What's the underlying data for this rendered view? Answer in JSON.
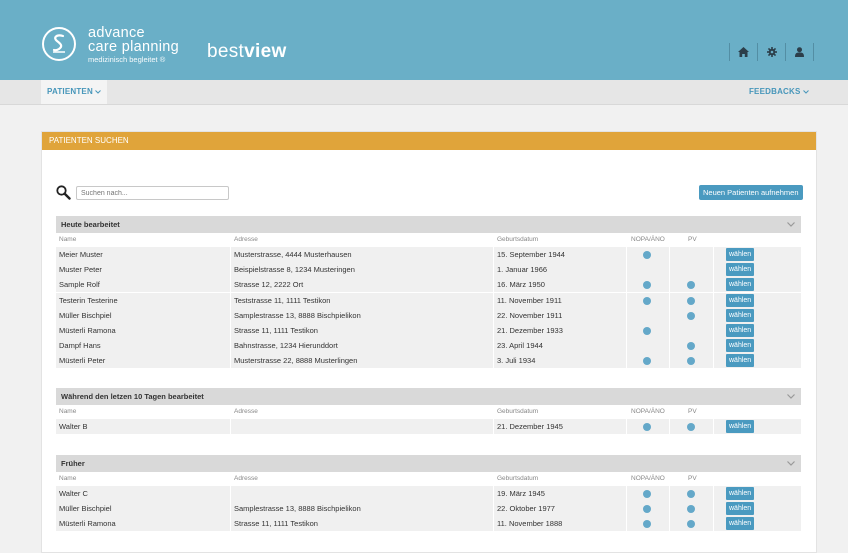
{
  "header": {
    "logo_line1": "advance",
    "logo_line2": "care planning",
    "logo_line3": "medizinisch begleitet ®",
    "brand_light": "best",
    "brand_bold": "view",
    "icons": [
      "home-icon",
      "gear-icon",
      "user-icon"
    ]
  },
  "nav": {
    "patients": "PATIENTEN",
    "feedbacks": "FEEDBACKS"
  },
  "panel": {
    "title": "PATIENTEN SUCHEN",
    "search_placeholder": "Suchen nach...",
    "new_patient_button": "Neuen Patienten aufnehmen"
  },
  "columns": {
    "name": "Name",
    "address": "Adresse",
    "birthdate": "Geburtsdatum",
    "nopa": "NOPA/ÄNO",
    "pv": "PV"
  },
  "action_label": "wählen",
  "sections": [
    {
      "title": "Heute bearbeitet",
      "rows": [
        {
          "name": "Meier Muster",
          "address": "Musterstrasse, 4444 Musterhausen",
          "birthdate": "15. September 1944",
          "nopa": true,
          "pv": false
        },
        {
          "name": "Muster Peter",
          "address": "Beispielstrasse 8, 1234 Musteringen",
          "birthdate": "1. Januar 1966",
          "nopa": false,
          "pv": false
        },
        {
          "name": "Sample Rolf",
          "address": "Strasse 12, 2222 Ort",
          "birthdate": "16. März 1950",
          "nopa": true,
          "pv": true
        },
        {
          "name": "Testerin Testerine",
          "address": "Teststrasse 11, 1111 Testikon",
          "birthdate": "11. November 1911",
          "nopa": true,
          "pv": true
        },
        {
          "name": "Müller Bischpiel",
          "address": "Samplestrasse 13, 8888 Bischpielikon",
          "birthdate": "22. November 1911",
          "nopa": false,
          "pv": true
        },
        {
          "name": "Müsterli Ramona",
          "address": "Strasse 11, 1111 Testikon",
          "birthdate": "21. Dezember 1933",
          "nopa": true,
          "pv": false
        },
        {
          "name": "Dampf Hans",
          "address": "Bahnstrasse, 1234 Hierunddort",
          "birthdate": "23. April 1944",
          "nopa": false,
          "pv": true
        },
        {
          "name": "Müsterli Peter",
          "address": "Musterstrasse 22, 8888 Musterlingen",
          "birthdate": "3. Juli 1934",
          "nopa": true,
          "pv": true
        }
      ]
    },
    {
      "title": "Während den letzen 10 Tagen bearbeitet",
      "rows": [
        {
          "name": "Walter B",
          "address": "",
          "birthdate": "21. Dezember 1945",
          "nopa": true,
          "pv": true
        }
      ]
    },
    {
      "title": "Früher",
      "rows": [
        {
          "name": "Walter C",
          "address": "",
          "birthdate": "19. März 1945",
          "nopa": true,
          "pv": true
        },
        {
          "name": "Müller Bischpiel",
          "address": "Samplestrasse 13, 8888 Bischpielikon",
          "birthdate": "22. Oktober 1977",
          "nopa": true,
          "pv": true
        },
        {
          "name": "Müsterli Ramona",
          "address": "Strasse 11, 1111 Testikon",
          "birthdate": "11. November 1888",
          "nopa": true,
          "pv": true
        }
      ]
    }
  ]
}
